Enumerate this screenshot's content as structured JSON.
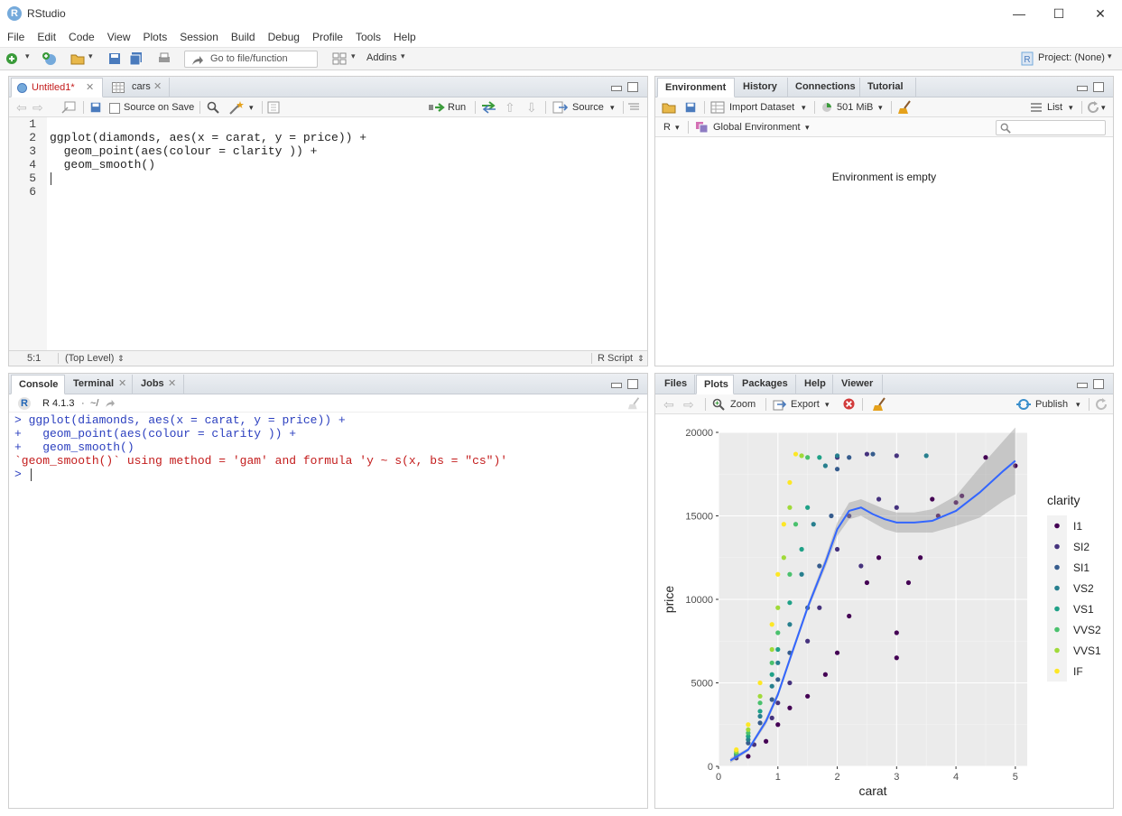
{
  "app": {
    "title": "RStudio",
    "icon_letter": "R"
  },
  "menu": [
    "File",
    "Edit",
    "Code",
    "View",
    "Plots",
    "Session",
    "Build",
    "Debug",
    "Profile",
    "Tools",
    "Help"
  ],
  "toolbar": {
    "goto_placeholder": "Go to file/function",
    "addins_label": "Addins",
    "project_label": "Project: (None)"
  },
  "editor": {
    "tabs": [
      {
        "label": "Untitled1*",
        "active": true
      },
      {
        "label": "cars",
        "active": false
      }
    ],
    "source_on_save": "Source on Save",
    "run_label": "Run",
    "source_label": "Source",
    "line_numbers": [
      "1",
      "2",
      "3",
      "4",
      "5",
      "6"
    ],
    "code": [
      "",
      "ggplot(diamonds, aes(x = carat, y = price)) +",
      "  geom_point(aes(colour = clarity )) +",
      "  geom_smooth()",
      "",
      ""
    ],
    "status_pos": "5:1",
    "status_scope": "(Top Level)",
    "status_type": "R Script"
  },
  "environment": {
    "tabs": [
      "Environment",
      "History",
      "Connections",
      "Tutorial"
    ],
    "import_label": "Import Dataset",
    "memory_label": "501 MiB",
    "list_label": "List",
    "lang_label": "R",
    "scope_label": "Global Environment",
    "empty_message": "Environment is empty"
  },
  "console": {
    "tabs": [
      "Console",
      "Terminal",
      "Jobs"
    ],
    "version": "R 4.1.3",
    "path": "~/",
    "lines": [
      {
        "text": "> ggplot(diamonds, aes(x = carat, y = price)) +",
        "kind": "input"
      },
      {
        "text": "+   geom_point(aes(colour = clarity )) +",
        "kind": "input"
      },
      {
        "text": "+   geom_smooth()",
        "kind": "input"
      },
      {
        "text": "`geom_smooth()` using method = 'gam' and formula 'y ~ s(x, bs = \"cs\")'",
        "kind": "message"
      },
      {
        "text": "> ",
        "kind": "prompt"
      }
    ]
  },
  "plots": {
    "tabs": [
      "Files",
      "Plots",
      "Packages",
      "Help",
      "Viewer"
    ],
    "zoom_label": "Zoom",
    "export_label": "Export",
    "publish_label": "Publish"
  },
  "chart_data": {
    "type": "scatter",
    "title": "",
    "xlabel": "carat",
    "ylabel": "price",
    "xlim": [
      0,
      5.2
    ],
    "ylim": [
      0,
      20000
    ],
    "x_ticks": [
      0,
      1,
      2,
      3,
      4,
      5
    ],
    "y_ticks": [
      0,
      5000,
      10000,
      15000,
      20000
    ],
    "x_tick_labels": [
      "0",
      "1",
      "2",
      "3",
      "4",
      "5"
    ],
    "y_tick_labels": [
      "0",
      "5000",
      "10000",
      "15000",
      "20000"
    ],
    "grid": true,
    "legend_title": "clarity",
    "legend_position": "right",
    "series": [
      {
        "name": "I1",
        "color": "#440154",
        "points": [
          [
            0.5,
            600
          ],
          [
            0.8,
            1500
          ],
          [
            1.0,
            2500
          ],
          [
            1.2,
            3500
          ],
          [
            1.5,
            4200
          ],
          [
            1.8,
            5500
          ],
          [
            2.0,
            6800
          ],
          [
            2.2,
            9000
          ],
          [
            2.5,
            11000
          ],
          [
            2.7,
            12500
          ],
          [
            3.0,
            8000
          ],
          [
            3.0,
            6500
          ],
          [
            3.2,
            11000
          ],
          [
            3.4,
            12500
          ],
          [
            3.6,
            16000
          ],
          [
            3.7,
            15000
          ],
          [
            4.0,
            15800
          ],
          [
            4.1,
            16200
          ],
          [
            4.5,
            18500
          ],
          [
            5.0,
            18000
          ]
        ]
      },
      {
        "name": "SI2",
        "color": "#46337e",
        "points": [
          [
            0.3,
            500
          ],
          [
            0.6,
            1300
          ],
          [
            0.9,
            2900
          ],
          [
            1.0,
            3800
          ],
          [
            1.2,
            5000
          ],
          [
            1.5,
            7500
          ],
          [
            1.7,
            9500
          ],
          [
            2.0,
            13000
          ],
          [
            2.0,
            18500
          ],
          [
            2.2,
            15000
          ],
          [
            2.4,
            12000
          ],
          [
            2.5,
            18700
          ],
          [
            2.7,
            16000
          ],
          [
            3.0,
            15500
          ],
          [
            3.0,
            18600
          ]
        ]
      },
      {
        "name": "SI1",
        "color": "#365c8d",
        "points": [
          [
            0.3,
            600
          ],
          [
            0.5,
            1400
          ],
          [
            0.7,
            2600
          ],
          [
            0.9,
            4000
          ],
          [
            1.0,
            5200
          ],
          [
            1.2,
            6800
          ],
          [
            1.5,
            9500
          ],
          [
            1.7,
            12000
          ],
          [
            1.9,
            15000
          ],
          [
            2.0,
            17800
          ],
          [
            2.2,
            18500
          ],
          [
            2.6,
            18700
          ]
        ]
      },
      {
        "name": "VS2",
        "color": "#277f8e",
        "points": [
          [
            0.3,
            700
          ],
          [
            0.5,
            1600
          ],
          [
            0.7,
            3000
          ],
          [
            0.9,
            4800
          ],
          [
            1.0,
            6200
          ],
          [
            1.2,
            8500
          ],
          [
            1.4,
            11500
          ],
          [
            1.6,
            14500
          ],
          [
            1.8,
            18000
          ],
          [
            2.0,
            18600
          ],
          [
            3.5,
            18600
          ]
        ]
      },
      {
        "name": "VS1",
        "color": "#1fa187",
        "points": [
          [
            0.3,
            750
          ],
          [
            0.5,
            1800
          ],
          [
            0.7,
            3300
          ],
          [
            0.9,
            5500
          ],
          [
            1.0,
            7000
          ],
          [
            1.2,
            9800
          ],
          [
            1.4,
            13000
          ],
          [
            1.5,
            15500
          ],
          [
            1.7,
            18500
          ]
        ]
      },
      {
        "name": "VVS2",
        "color": "#4ac16d",
        "points": [
          [
            0.3,
            800
          ],
          [
            0.5,
            2000
          ],
          [
            0.7,
            3800
          ],
          [
            0.9,
            6200
          ],
          [
            1.0,
            8000
          ],
          [
            1.2,
            11500
          ],
          [
            1.3,
            14500
          ],
          [
            1.5,
            18500
          ]
        ]
      },
      {
        "name": "VVS1",
        "color": "#a0da39",
        "points": [
          [
            0.3,
            900
          ],
          [
            0.5,
            2200
          ],
          [
            0.7,
            4200
          ],
          [
            0.9,
            7000
          ],
          [
            1.0,
            9500
          ],
          [
            1.1,
            12500
          ],
          [
            1.2,
            15500
          ],
          [
            1.4,
            18600
          ]
        ]
      },
      {
        "name": "IF",
        "color": "#fde725",
        "points": [
          [
            0.3,
            1000
          ],
          [
            0.5,
            2500
          ],
          [
            0.7,
            5000
          ],
          [
            0.9,
            8500
          ],
          [
            1.0,
            11500
          ],
          [
            1.1,
            14500
          ],
          [
            1.2,
            17000
          ],
          [
            1.3,
            18700
          ]
        ]
      }
    ],
    "smooth": {
      "color": "#3366ff",
      "band_color": "#999999",
      "x": [
        0.2,
        0.5,
        0.8,
        1.0,
        1.2,
        1.5,
        1.8,
        2.0,
        2.2,
        2.4,
        2.6,
        2.8,
        3.0,
        3.3,
        3.6,
        4.0,
        4.4,
        4.8,
        5.0
      ],
      "y": [
        350,
        1000,
        2700,
        4300,
        6400,
        9500,
        12200,
        14200,
        15300,
        15500,
        15100,
        14800,
        14600,
        14600,
        14700,
        15300,
        16400,
        17700,
        18300
      ],
      "band_upper": [
        500,
        1100,
        2900,
        4500,
        6600,
        9700,
        12500,
        14600,
        15800,
        16000,
        15700,
        15400,
        15200,
        15200,
        15400,
        16200,
        17900,
        19500,
        20300
      ],
      "band_lower": [
        200,
        900,
        2500,
        4100,
        6200,
        9300,
        11900,
        13800,
        14800,
        15000,
        14600,
        14200,
        14000,
        14000,
        14000,
        14400,
        14900,
        15900,
        16300
      ]
    }
  }
}
